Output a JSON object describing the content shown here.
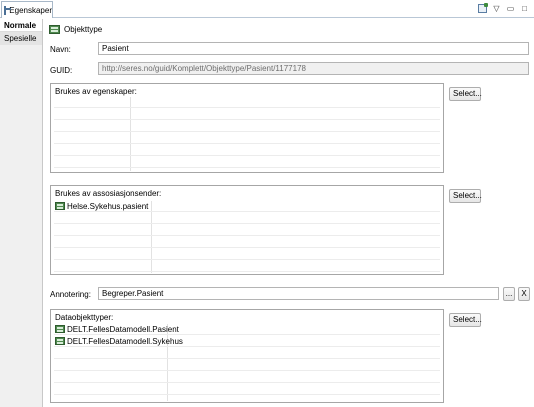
{
  "view": {
    "tab_title": "Egenskaper",
    "icons": [
      "pin-icon",
      "view-menu-icon",
      "minimize-icon",
      "maximize-icon"
    ]
  },
  "side_tabs": [
    "Normale",
    "Spesielle"
  ],
  "header": {
    "type_label": "Objekttype",
    "icon": "class-icon"
  },
  "form": {
    "name_label": "Navn:",
    "name_value": "Pasient",
    "guid_label": "GUID:",
    "guid_value": "http://seres.no/guid/Komplett/Objekttype/Pasient/1177178"
  },
  "used_by_properties": {
    "title": "Brukes av egenskaper:",
    "items": [],
    "select_label": "Select..."
  },
  "used_by_associations": {
    "title": "Brukes av assosiasjonsender:",
    "items": [
      "Helse.Sykehus.pasient"
    ],
    "select_label": "Select..."
  },
  "annotation": {
    "label": "Annotering:",
    "value": "Begreper.Pasient",
    "browse_label": "...",
    "clear_label": "X"
  },
  "data_object_types": {
    "title": "Dataobjekttyper:",
    "items": [
      "DELT.FellesDatamodell.Pasient",
      "DELT.FellesDatamodell.Sykehus"
    ],
    "select_label": "Select..."
  }
}
